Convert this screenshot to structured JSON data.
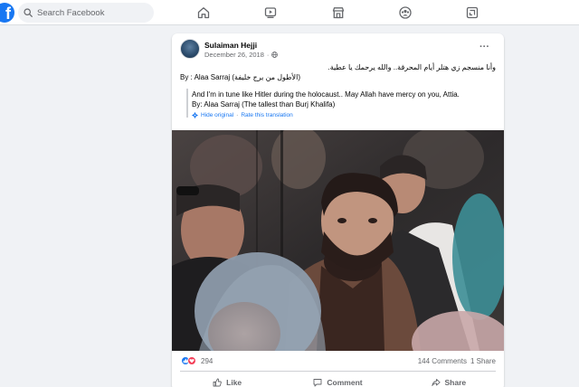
{
  "header": {
    "search_placeholder": "Search Facebook",
    "brand_color": "#1877f2",
    "nav_icons": [
      "home-icon",
      "watch-icon",
      "marketplace-icon",
      "groups-icon",
      "gaming-icon"
    ]
  },
  "post": {
    "author": "Sulaiman Hejji",
    "date": "December 26, 2018",
    "separator": "·",
    "privacy_icon": "globe-icon",
    "more_label": "···",
    "text_arabic_line1": "وأنا منسجم زي هتلر أيام المحرقة..  والله يرحمك يا عطية.",
    "text_arabic_line2": "By : Alaa Sarraj (الأطول من برج خليفة)",
    "translation_line1": "And I'm in tune like Hitler during the holocaust.. May Allah have mercy on you, Attia.",
    "translation_line2": "By: Alaa Sarraj (The tallest than Burj Khalifa)",
    "hide_original": "Hide original",
    "link_separator": "·",
    "rate_translation": "Rate this translation",
    "reaction_count": "294",
    "comments": "144 Comments",
    "shares": "1 Share",
    "actions": {
      "like": "Like",
      "comment": "Comment",
      "share": "Share"
    }
  }
}
